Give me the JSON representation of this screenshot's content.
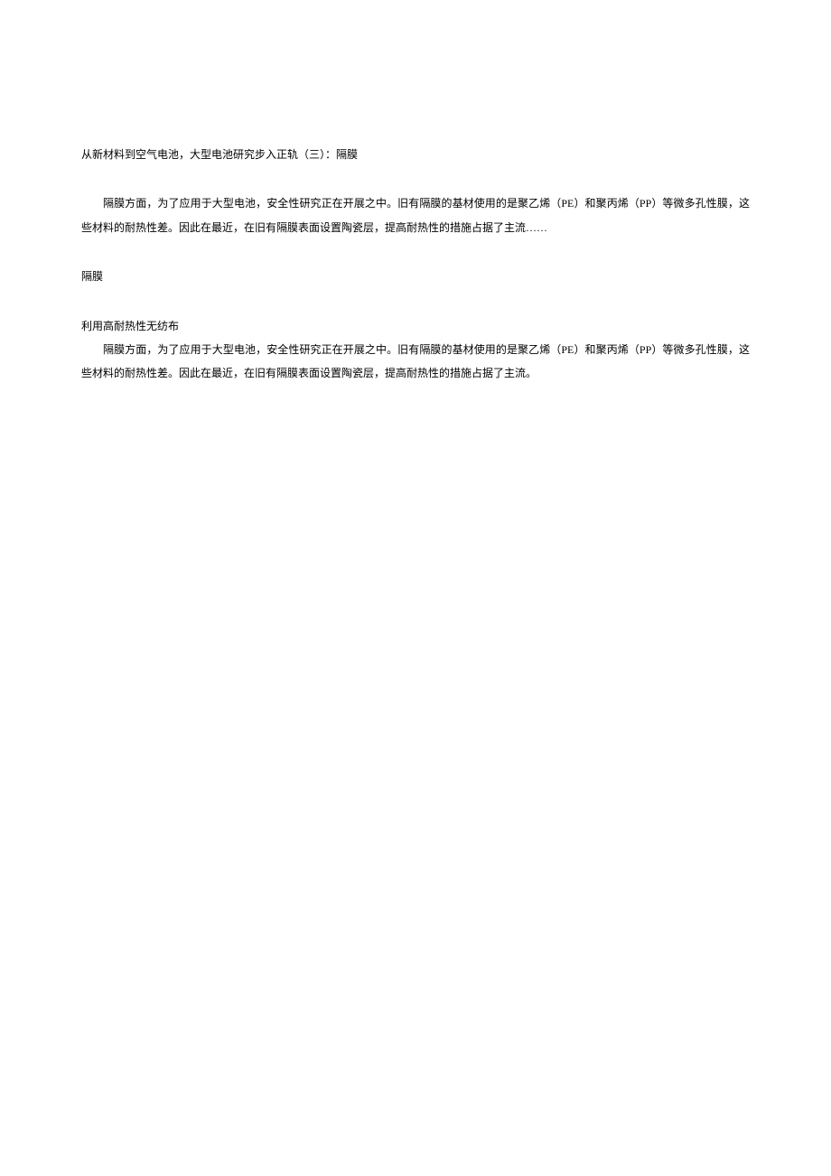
{
  "title": "从新材料到空气电池，大型电池研究步入正轨（三）：隔膜",
  "abstract": "隔膜方面，为了应用于大型电池，安全性研究正在开展之中。旧有隔膜的基材使用的是聚乙烯（PE）和聚丙烯（PP）等微多孔性膜，这些材料的耐热性差。因此在最近，在旧有隔膜表面设置陶瓷层，提高耐热性的措施占据了主流……",
  "section_heading": "隔膜",
  "subsection_heading": "利用高耐热性无纺布",
  "body_paragraph_1": "隔膜方面，为了应用于大型电池，安全性研究正在开展之中。旧有隔膜的基材使用的是聚乙烯（PE）和聚丙烯（PP）等微多孔性膜，这些材料的耐热性差。因此在最近，在旧有隔膜表面设置陶瓷层，提高耐热性的措施占据了主流。"
}
